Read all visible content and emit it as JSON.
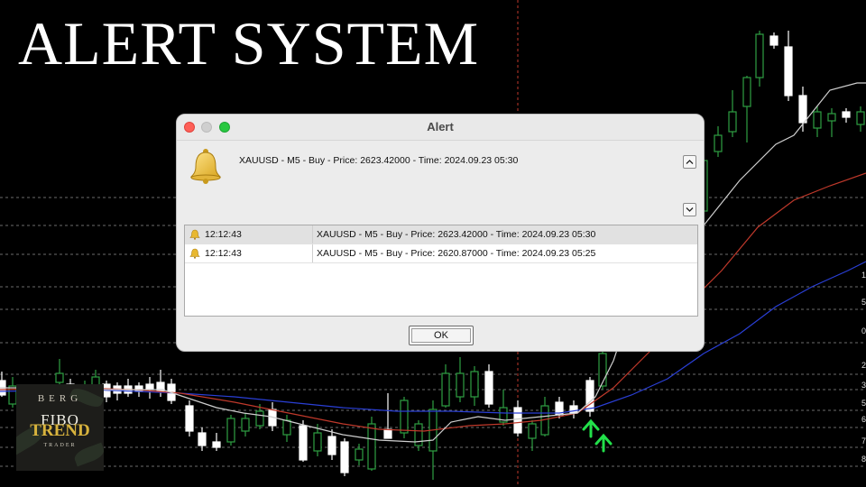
{
  "headline": "ALERT SYSTEM",
  "logo": {
    "line1": "BERG",
    "line2": "FIBO",
    "line3": "TREND",
    "line4": "TRADER"
  },
  "chart": {
    "instrument_colors": {
      "background": "#000000",
      "bull_candle": "#ffffff",
      "bear_candle": "#2ea043",
      "gridline": "#6b6b6b",
      "crosshair": "#c0392b",
      "ma_fast": "#cfcfcf",
      "ma_mid": "#c0392b",
      "ma_slow": "#2a3fd6",
      "buy_arrow": "#22e04a"
    },
    "right_axis_ticks": [
      "1",
      "5",
      "0",
      "2",
      "3",
      "5",
      "6",
      "7",
      "8"
    ]
  },
  "dialog": {
    "title": "Alert",
    "message": "XAUUSD - M5 - Buy - Price: 2623.42000 - Time: 2024.09.23 05:30",
    "scroll_up_icon": "chevron-up-icon",
    "scroll_down_icon": "chevron-down-icon",
    "history": [
      {
        "time": "12:12:43",
        "text": "XAUUSD - M5 - Buy - Price: 2623.42000 - Time: 2024.09.23 05:30",
        "selected": true
      },
      {
        "time": "12:12:43",
        "text": "XAUUSD - M5 - Buy - Price: 2620.87000 - Time: 2024.09.23 05:25",
        "selected": false
      }
    ],
    "ok_label": "OK"
  }
}
